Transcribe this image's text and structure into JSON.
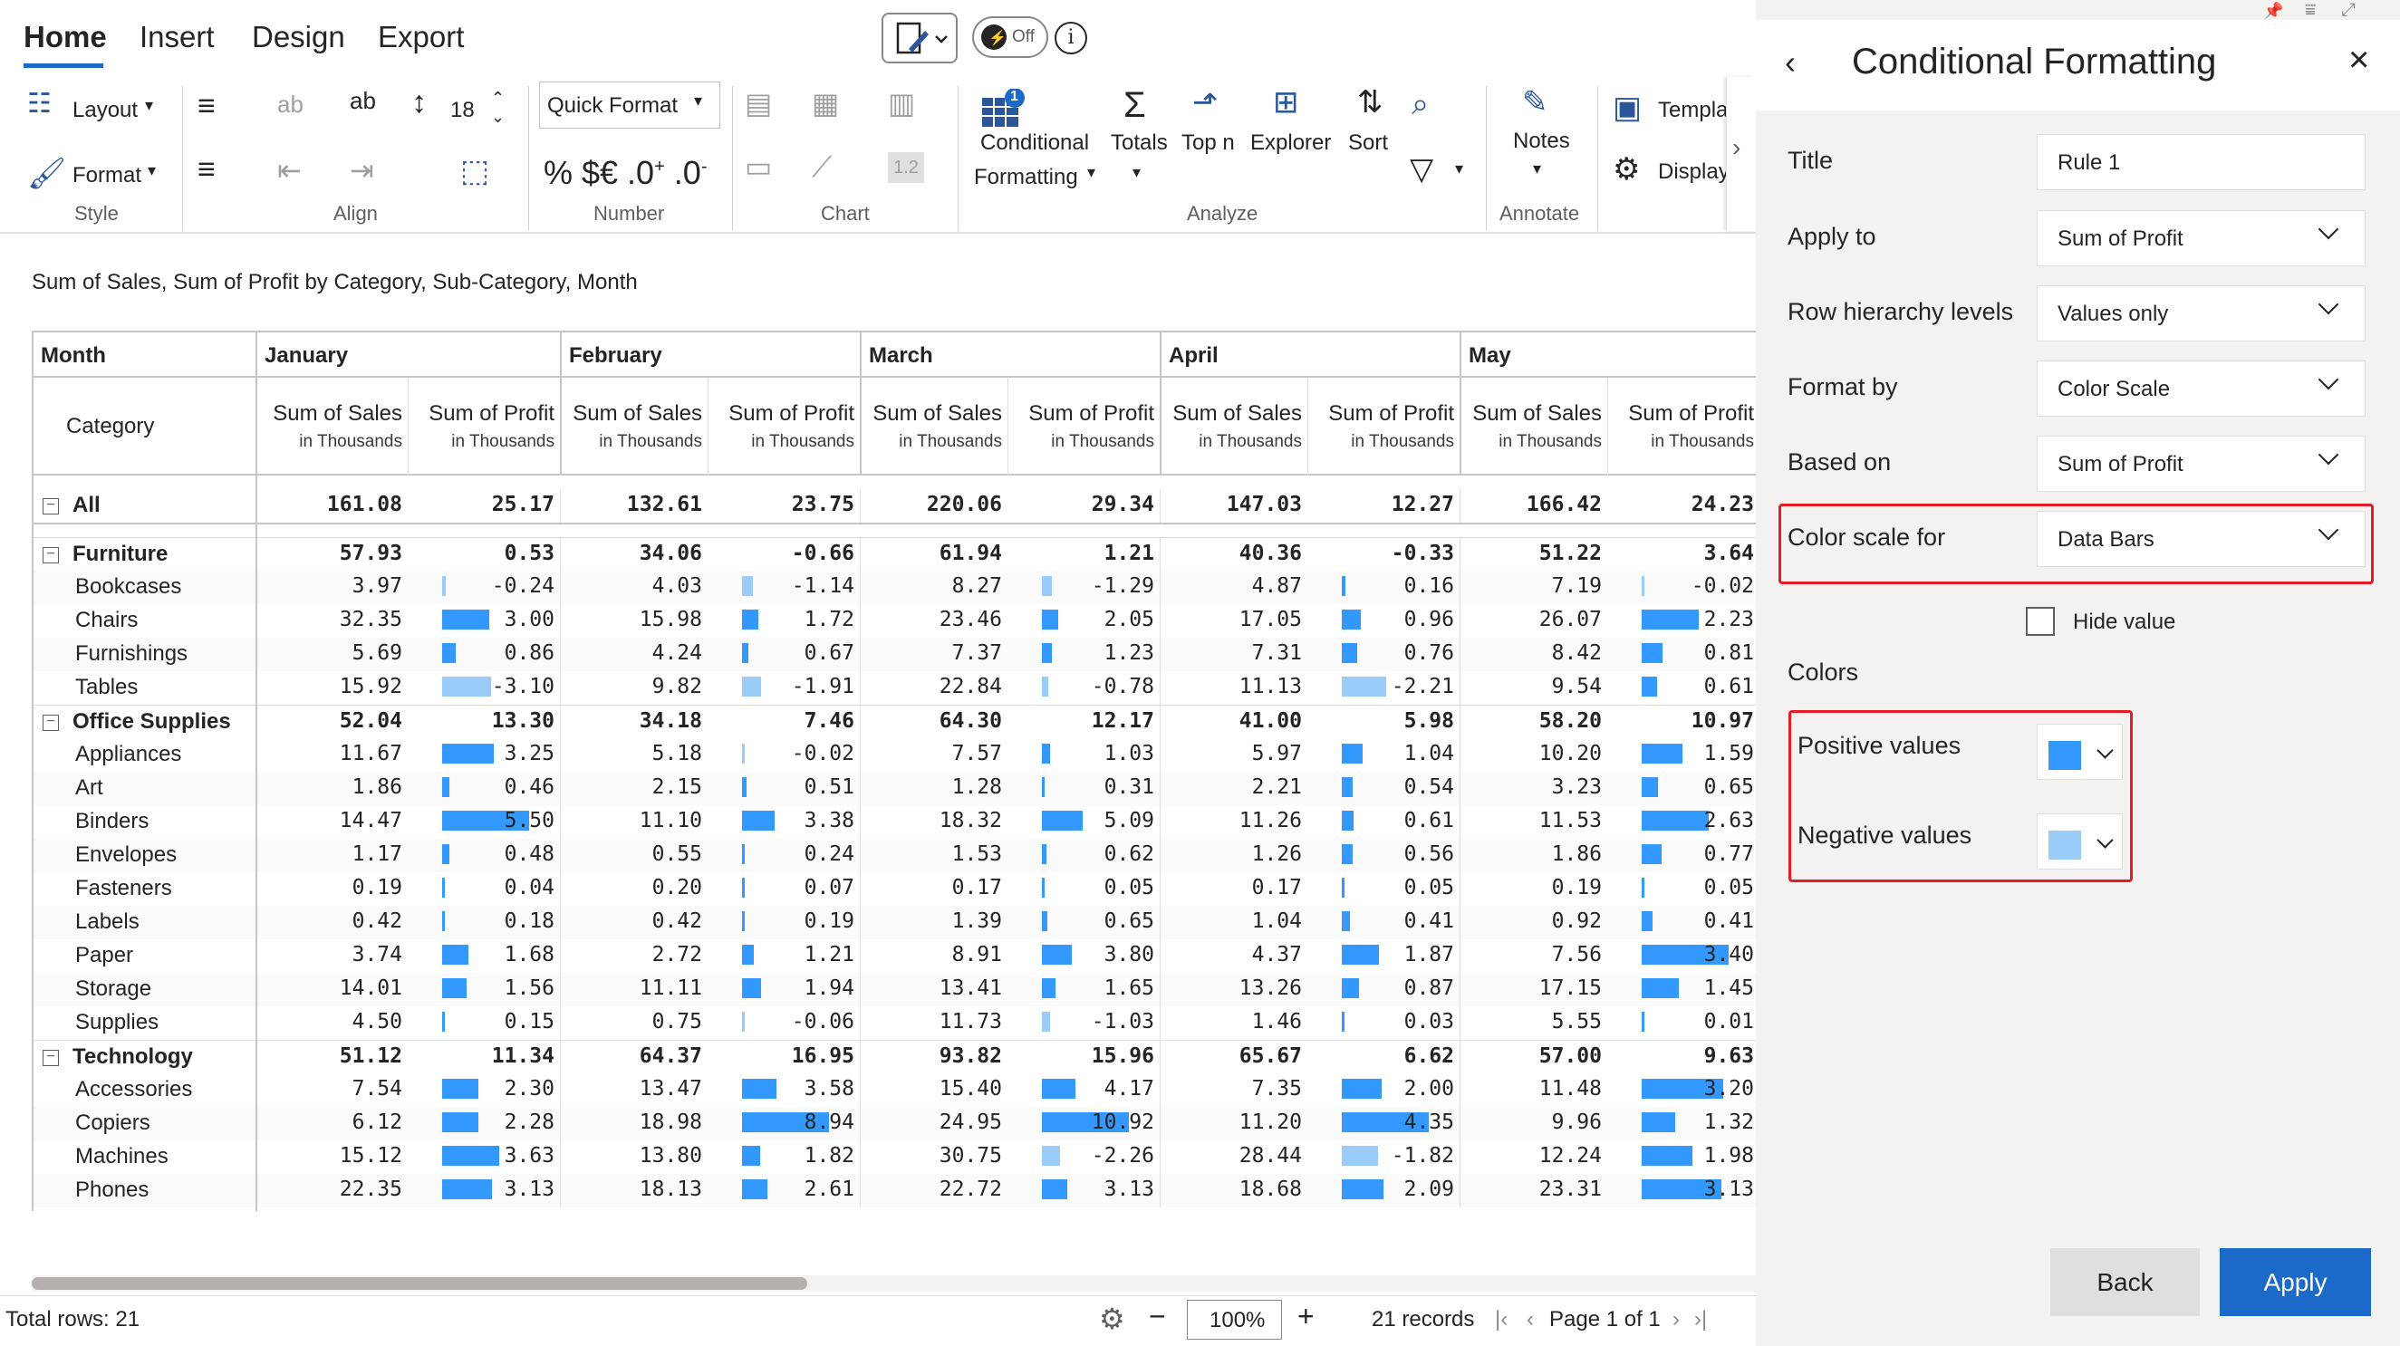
{
  "tabs": [
    "Home",
    "Insert",
    "Design",
    "Export"
  ],
  "ribbon": {
    "layout": "Layout",
    "format": "Format",
    "font_size": "18",
    "quick_format": "Quick Format",
    "conditional_formatting_1": "Conditional",
    "conditional_formatting_2": "Formatting",
    "totals": "Totals",
    "top_n": "Top n",
    "explorer": "Explorer",
    "sort": "Sort",
    "notes": "Notes",
    "templates": "Templa",
    "display": "Display",
    "toggle": "Off",
    "badge": "1",
    "decimals": "1.2",
    "groups": [
      "Style",
      "Align",
      "Number",
      "Chart",
      "Analyze",
      "Annotate"
    ]
  },
  "subtitle": "Sum of Sales, Sum of Profit by Category, Sub-Category, Month",
  "table": {
    "month_header": "Month",
    "category_header": "Category",
    "months": [
      "January",
      "February",
      "March",
      "April",
      "May"
    ],
    "measure_sales": "Sum of Sales",
    "measure_profit": "Sum of Profit",
    "unit": "in Thousands",
    "rows": [
      {
        "label": "All",
        "level": 0,
        "bold": true,
        "expander": true,
        "v": [
          "161.08",
          "25.17",
          "132.61",
          "23.75",
          "220.06",
          "29.34",
          "147.03",
          "12.27",
          "166.42",
          "24.23"
        ]
      },
      {
        "label": "Furniture",
        "level": 0,
        "bold": true,
        "expander": true,
        "v": [
          "57.93",
          "0.53",
          "34.06",
          "-0.66",
          "61.94",
          "1.21",
          "40.36",
          "-0.33",
          "51.22",
          "3.64"
        ]
      },
      {
        "label": "Bookcases",
        "level": 1,
        "v": [
          "3.97",
          "-0.24",
          "4.03",
          "-1.14",
          "8.27",
          "-1.29",
          "4.87",
          "0.16",
          "7.19",
          "-0.02"
        ]
      },
      {
        "label": "Chairs",
        "level": 1,
        "v": [
          "32.35",
          "3.00",
          "15.98",
          "1.72",
          "23.46",
          "2.05",
          "17.05",
          "0.96",
          "26.07",
          "2.23"
        ]
      },
      {
        "label": "Furnishings",
        "level": 1,
        "v": [
          "5.69",
          "0.86",
          "4.24",
          "0.67",
          "7.37",
          "1.23",
          "7.31",
          "0.76",
          "8.42",
          "0.81"
        ]
      },
      {
        "label": "Tables",
        "level": 1,
        "v": [
          "15.92",
          "-3.10",
          "9.82",
          "-1.91",
          "22.84",
          "-0.78",
          "11.13",
          "-2.21",
          "9.54",
          "0.61"
        ]
      },
      {
        "label": "Office Supplies",
        "level": 0,
        "bold": true,
        "expander": true,
        "v": [
          "52.04",
          "13.30",
          "34.18",
          "7.46",
          "64.30",
          "12.17",
          "41.00",
          "5.98",
          "58.20",
          "10.97"
        ]
      },
      {
        "label": "Appliances",
        "level": 1,
        "v": [
          "11.67",
          "3.25",
          "5.18",
          "-0.02",
          "7.57",
          "1.03",
          "5.97",
          "1.04",
          "10.20",
          "1.59"
        ]
      },
      {
        "label": "Art",
        "level": 1,
        "v": [
          "1.86",
          "0.46",
          "2.15",
          "0.51",
          "1.28",
          "0.31",
          "2.21",
          "0.54",
          "3.23",
          "0.65"
        ]
      },
      {
        "label": "Binders",
        "level": 1,
        "v": [
          "14.47",
          "5.50",
          "11.10",
          "3.38",
          "18.32",
          "5.09",
          "11.26",
          "0.61",
          "11.53",
          "2.63"
        ]
      },
      {
        "label": "Envelopes",
        "level": 1,
        "v": [
          "1.17",
          "0.48",
          "0.55",
          "0.24",
          "1.53",
          "0.62",
          "1.26",
          "0.56",
          "1.86",
          "0.77"
        ]
      },
      {
        "label": "Fasteners",
        "level": 1,
        "v": [
          "0.19",
          "0.04",
          "0.20",
          "0.07",
          "0.17",
          "0.05",
          "0.17",
          "0.05",
          "0.19",
          "0.05"
        ]
      },
      {
        "label": "Labels",
        "level": 1,
        "v": [
          "0.42",
          "0.18",
          "0.42",
          "0.19",
          "1.39",
          "0.65",
          "1.04",
          "0.41",
          "0.92",
          "0.41"
        ]
      },
      {
        "label": "Paper",
        "level": 1,
        "v": [
          "3.74",
          "1.68",
          "2.72",
          "1.21",
          "8.91",
          "3.80",
          "4.37",
          "1.87",
          "7.56",
          "3.40"
        ]
      },
      {
        "label": "Storage",
        "level": 1,
        "v": [
          "14.01",
          "1.56",
          "11.11",
          "1.94",
          "13.41",
          "1.65",
          "13.26",
          "0.87",
          "17.15",
          "1.45"
        ]
      },
      {
        "label": "Supplies",
        "level": 1,
        "v": [
          "4.50",
          "0.15",
          "0.75",
          "-0.06",
          "11.73",
          "-1.03",
          "1.46",
          "0.03",
          "5.55",
          "0.01"
        ]
      },
      {
        "label": "Technology",
        "level": 0,
        "bold": true,
        "expander": true,
        "v": [
          "51.12",
          "11.34",
          "64.37",
          "16.95",
          "93.82",
          "15.96",
          "65.67",
          "6.62",
          "57.00",
          "9.63"
        ]
      },
      {
        "label": "Accessories",
        "level": 1,
        "v": [
          "7.54",
          "2.30",
          "13.47",
          "3.58",
          "15.40",
          "4.17",
          "7.35",
          "2.00",
          "11.48",
          "3.20"
        ]
      },
      {
        "label": "Copiers",
        "level": 1,
        "v": [
          "6.12",
          "2.28",
          "18.98",
          "8.94",
          "24.95",
          "10.92",
          "11.20",
          "4.35",
          "9.96",
          "1.32"
        ]
      },
      {
        "label": "Machines",
        "level": 1,
        "v": [
          "15.12",
          "3.63",
          "13.80",
          "1.82",
          "30.75",
          "-2.26",
          "28.44",
          "-1.82",
          "12.24",
          "1.98"
        ]
      },
      {
        "label": "Phones",
        "level": 1,
        "v": [
          "22.35",
          "3.13",
          "18.13",
          "2.61",
          "22.72",
          "3.13",
          "18.68",
          "2.09",
          "23.31",
          "3.13"
        ]
      }
    ]
  },
  "status": {
    "total_rows": "Total rows: 21",
    "zoom": "100%",
    "records": "21 records",
    "page": "Page 1 of 1"
  },
  "panel": {
    "title": "Conditional Formatting",
    "fields": [
      {
        "label": "Title",
        "value": "Rule 1",
        "dropdown": false
      },
      {
        "label": "Apply to",
        "value": "Sum of Profit",
        "dropdown": true
      },
      {
        "label": "Row hierarchy levels",
        "value": "Values only",
        "dropdown": true
      },
      {
        "label": "Format by",
        "value": "Color Scale",
        "dropdown": true
      },
      {
        "label": "Based on",
        "value": "Sum of Profit",
        "dropdown": true
      },
      {
        "label": "Color scale for",
        "value": "Data Bars",
        "dropdown": true
      }
    ],
    "hide_value": "Hide value",
    "colors_heading": "Colors",
    "positive_label": "Positive values",
    "negative_label": "Negative values",
    "positive_color": "#3399ff",
    "negative_color": "#99ccf8",
    "back": "Back",
    "apply": "Apply"
  }
}
